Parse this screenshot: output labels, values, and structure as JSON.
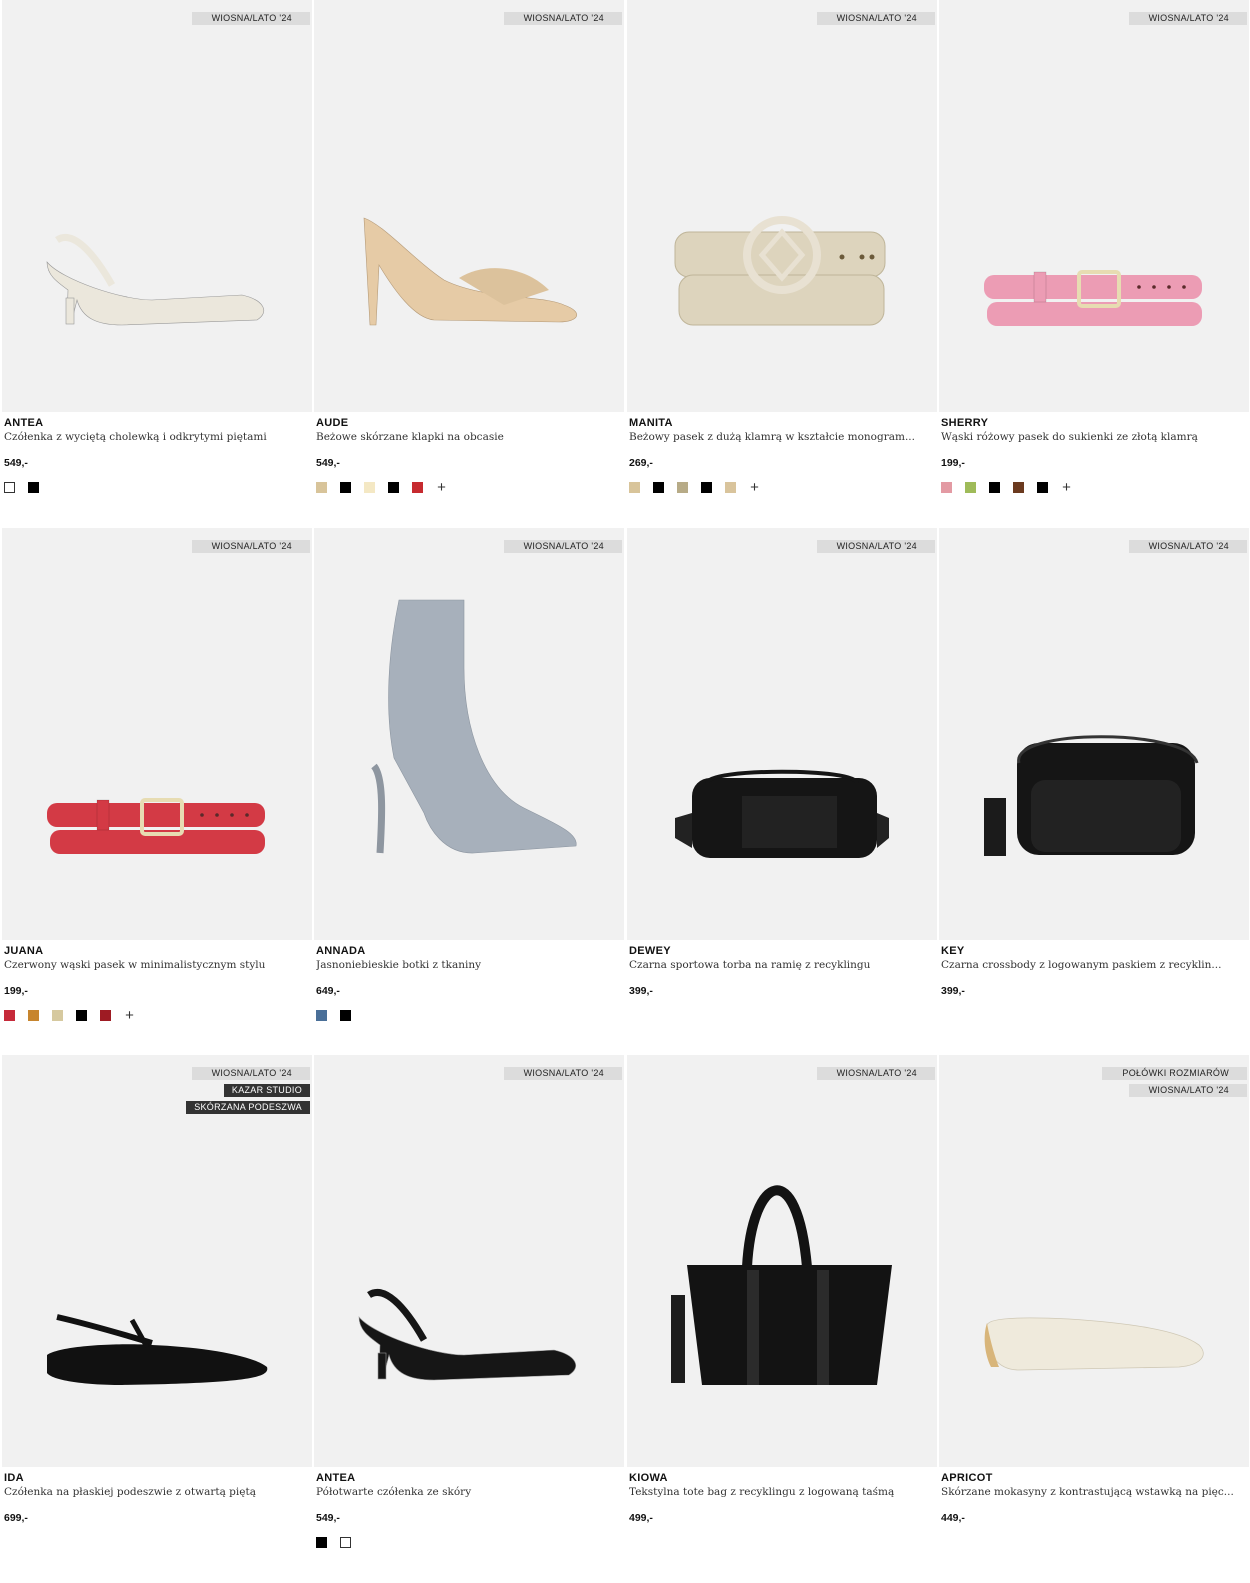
{
  "products": [
    {
      "tags": [
        {
          "text": "WIOSNA/LATO '24",
          "style": "light"
        }
      ],
      "name": "ANTEA",
      "desc": "Czółenka z wyciętą cholewką i odkrytymi piętami",
      "price": "549,-",
      "swatches": [
        "#ffffff",
        "#000000"
      ],
      "more": false,
      "icon": "slingback-pump-icon",
      "color": "#ebe7dc"
    },
    {
      "tags": [
        {
          "text": "WIOSNA/LATO '24",
          "style": "light"
        }
      ],
      "name": "AUDE",
      "desc": "Beżowe skórzane klapki na obcasie",
      "price": "549,-",
      "swatches": [
        "#d8c49a",
        "#000000",
        "#f4e8c4",
        "#000000",
        "#c62a2f"
      ],
      "more": true,
      "icon": "heeled-mule-icon",
      "color": "#e6cba6"
    },
    {
      "tags": [
        {
          "text": "WIOSNA/LATO '24",
          "style": "light"
        }
      ],
      "name": "MANITA",
      "desc": "Beżowy pasek z dużą klamrą w kształcie monogram...",
      "price": "269,-",
      "swatches": [
        "#d8c49a",
        "#000000",
        "#b7ab87",
        "#000000",
        "#d9c49c"
      ],
      "more": true,
      "icon": "belt-monogram-icon",
      "color": "#ddd4bd"
    },
    {
      "tags": [
        {
          "text": "WIOSNA/LATO '24",
          "style": "light"
        }
      ],
      "name": "SHERRY",
      "desc": "Wąski różowy pasek do sukienki ze złotą klamrą",
      "price": "199,-",
      "swatches": [
        "#e39aa3",
        "#9fbb59",
        "#000000",
        "#6b3a1f",
        "#000000"
      ],
      "more": true,
      "icon": "thin-belt-icon",
      "color": "#ec9cb4"
    },
    {
      "tags": [
        {
          "text": "WIOSNA/LATO '24",
          "style": "light"
        }
      ],
      "name": "JUANA",
      "desc": "Czerwony wąski pasek w minimalistycznym stylu",
      "price": "199,-",
      "swatches": [
        "#c62a3a",
        "#c7852e",
        "#d6c99f",
        "#000000",
        "#9e1b23"
      ],
      "more": true,
      "icon": "thin-belt-icon",
      "color": "#d33a45"
    },
    {
      "tags": [
        {
          "text": "WIOSNA/LATO '24",
          "style": "light"
        }
      ],
      "name": "ANNADA",
      "desc": "Jasnoniebieskie botki z tkaniny",
      "price": "649,-",
      "swatches": [
        "#4a6f98",
        "#000000"
      ],
      "more": false,
      "icon": "ankle-boot-icon",
      "color": "#a7b0bb"
    },
    {
      "tags": [
        {
          "text": "WIOSNA/LATO '24",
          "style": "light"
        }
      ],
      "name": "DEWEY",
      "desc": "Czarna sportowa torba na ramię z recyklingu",
      "price": "399,-",
      "swatches": [],
      "more": false,
      "icon": "duffel-bag-icon",
      "color": "#151515"
    },
    {
      "tags": [
        {
          "text": "WIOSNA/LATO '24",
          "style": "light"
        }
      ],
      "name": "KEY",
      "desc": "Czarna crossbody z logowanym paskiem z recyklin...",
      "price": "399,-",
      "swatches": [],
      "more": false,
      "icon": "crossbody-bag-icon",
      "color": "#151515"
    },
    {
      "tags": [
        {
          "text": "WIOSNA/LATO '24",
          "style": "light"
        },
        {
          "text": "KAZAR STUDIO",
          "style": "dark"
        },
        {
          "text": "SKÓRZANA PODESZWA",
          "style": "dark"
        }
      ],
      "name": "IDA",
      "desc": "Czółenka na płaskiej podeszwie z otwartą piętą",
      "price": "699,-",
      "swatches": [],
      "more": false,
      "icon": "flat-slingback-icon",
      "color": "#111111"
    },
    {
      "tags": [
        {
          "text": "WIOSNA/LATO '24",
          "style": "light"
        }
      ],
      "name": "ANTEA",
      "desc": "Półotwarte czółenka ze skóry",
      "price": "549,-",
      "swatches": [
        "#000000",
        "#ffffff"
      ],
      "more": false,
      "icon": "slingback-pump-icon",
      "color": "#161616"
    },
    {
      "tags": [
        {
          "text": "WIOSNA/LATO '24",
          "style": "light"
        }
      ],
      "name": "KIOWA",
      "desc": "Tekstylna tote bag z recyklingu z logowaną taśmą",
      "price": "499,-",
      "swatches": [],
      "more": false,
      "icon": "tote-bag-icon",
      "color": "#131313"
    },
    {
      "tags": [
        {
          "text": "POŁÓWKI ROZMIARÓW",
          "style": "light"
        },
        {
          "text": "WIOSNA/LATO '24",
          "style": "light"
        }
      ],
      "name": "APRICOT",
      "desc": "Skórzane mokasyny z kontrastującą wstawką na pięc...",
      "price": "449,-",
      "swatches": [],
      "more": false,
      "icon": "loafer-icon",
      "color": "#efeadc"
    }
  ],
  "plus_symbol": "+"
}
